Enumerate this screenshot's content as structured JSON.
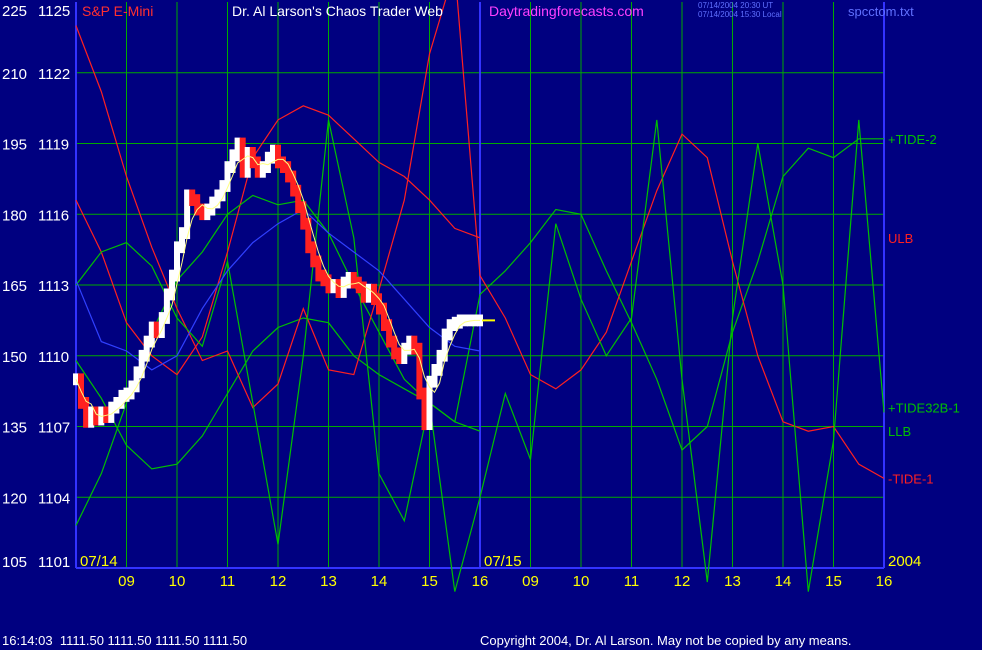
{
  "header": {
    "instrument": "S&P E-Mini",
    "title": "Dr. Al Larson's Chaos Trader Web",
    "site": "Daytradingforecasts.com",
    "timestamp_ut": "07/14/2004 20:30 UT",
    "timestamp_local": "07/14/2004 15:30 Local",
    "filename": "spcctom.txt"
  },
  "footer": {
    "quote": "16:14:03  1111.50 1111.50 1111.50 1111.50",
    "copyright": "Copyright 2004, Dr. Al Larson. May not be copied by any means."
  },
  "colors": {
    "background": "#000080",
    "frame": "#3333ff",
    "grid": "#00aa00",
    "axis_text": "#ffff00",
    "price_label": "#ffffff",
    "red": "#ff2020",
    "green": "#00c000",
    "white": "#ffffff"
  },
  "chart_data": {
    "type": "line",
    "x_unit": "hour of day (session 07/14 starts at 08, session 07/15 starts at 16)",
    "left_axis_outer": {
      "range": [
        105,
        225
      ],
      "ticks": [
        225,
        210,
        195,
        180,
        165,
        150,
        135,
        120,
        105
      ]
    },
    "left_axis_inner": {
      "range": [
        1101,
        1125
      ],
      "ticks": [
        1125,
        1122,
        1119,
        1116,
        1113,
        1110,
        1107,
        1104,
        1101
      ]
    },
    "day_markers": [
      {
        "label": "07/14",
        "x": 8
      },
      {
        "label": "07/15",
        "x": 16
      },
      {
        "label": "2004",
        "x": 24
      }
    ],
    "hour_ticks": [
      {
        "label": "09",
        "x": 9
      },
      {
        "label": "10",
        "x": 10
      },
      {
        "label": "11",
        "x": 11
      },
      {
        "label": "12",
        "x": 12
      },
      {
        "label": "13",
        "x": 13
      },
      {
        "label": "14",
        "x": 14
      },
      {
        "label": "15",
        "x": 15
      },
      {
        "label": "16",
        "x": 16
      },
      {
        "label": "09",
        "x": 17
      },
      {
        "label": "10",
        "x": 18
      },
      {
        "label": "11",
        "x": 19
      },
      {
        "label": "12",
        "x": 20
      },
      {
        "label": "13",
        "x": 21
      },
      {
        "label": "14",
        "x": 22
      },
      {
        "label": "15",
        "x": 23
      },
      {
        "label": "16",
        "x": 24
      }
    ],
    "grid": true,
    "price_bars": {
      "name": "S&P E-Mini",
      "x": [
        8.0,
        8.1,
        8.2,
        8.3,
        8.4,
        8.5,
        8.6,
        8.7,
        8.8,
        8.9,
        9.0,
        9.1,
        9.2,
        9.3,
        9.4,
        9.5,
        9.6,
        9.7,
        9.8,
        9.9,
        10.0,
        10.1,
        10.2,
        10.3,
        10.4,
        10.5,
        10.6,
        10.7,
        10.8,
        10.9,
        11.0,
        11.1,
        11.2,
        11.3,
        11.4,
        11.5,
        11.6,
        11.7,
        11.8,
        11.9,
        12.0,
        12.1,
        12.2,
        12.3,
        12.4,
        12.5,
        12.6,
        12.7,
        12.8,
        12.9,
        13.0,
        13.1,
        13.2,
        13.3,
        13.4,
        13.5,
        13.6,
        13.7,
        13.8,
        13.9,
        14.0,
        14.1,
        14.2,
        14.3,
        14.4,
        14.5,
        14.6,
        14.7,
        14.8,
        14.9,
        15.0,
        15.1,
        15.2,
        15.3,
        15.4,
        15.5,
        15.6,
        15.7,
        15.8,
        15.9,
        16.0
      ],
      "close": [
        1109.0,
        1108.0,
        1107.2,
        1107.6,
        1107.3,
        1107.6,
        1107.4,
        1107.8,
        1108.0,
        1108.3,
        1108.4,
        1108.7,
        1109.3,
        1110.0,
        1110.6,
        1111.2,
        1111.0,
        1111.6,
        1112.6,
        1113.4,
        1114.6,
        1115.2,
        1116.8,
        1116.6,
        1116.2,
        1116.0,
        1116.2,
        1116.5,
        1116.8,
        1117.2,
        1118.0,
        1118.5,
        1119.0,
        1117.8,
        1118.6,
        1118.2,
        1117.8,
        1118.0,
        1118.4,
        1118.7,
        1118.2,
        1118.0,
        1117.6,
        1117.0,
        1116.3,
        1115.6,
        1114.6,
        1114.0,
        1113.4,
        1113.2,
        1112.9,
        1113.0,
        1112.7,
        1113.1,
        1113.3,
        1113.1,
        1112.9,
        1112.5,
        1112.8,
        1112.4,
        1112.0,
        1111.3,
        1110.6,
        1110.1,
        1109.9,
        1110.3,
        1110.6,
        1110.3,
        1108.4,
        1107.1,
        1108.9,
        1109.4,
        1110.0,
        1110.9,
        1111.3,
        1111.4,
        1111.5,
        1111.5,
        1111.5,
        1111.5,
        1111.5
      ],
      "last": 1111.5
    },
    "series": [
      {
        "name": "ULB",
        "color": "#ff2020",
        "x": [
          8.0,
          8.5,
          9.0,
          9.5,
          10.0,
          10.5,
          11.0,
          11.5,
          12.0,
          12.5,
          13.0,
          13.5,
          14.0,
          14.5,
          15.0,
          15.5,
          16.0
        ],
        "y": [
          183,
          172,
          157,
          150,
          146,
          154,
          172,
          192,
          200,
          203,
          201,
          196,
          191,
          188,
          183,
          177,
          175
        ]
      },
      {
        "name": "LLB",
        "color": "#00c000",
        "x": [
          8.0,
          8.5,
          9.0,
          9.5,
          10.0,
          10.5,
          11.0,
          11.5,
          12.0,
          12.5,
          13.0,
          13.5,
          14.0,
          14.5,
          15.0,
          15.5,
          16.0
        ],
        "y": [
          149,
          141,
          131,
          126,
          127,
          133,
          142,
          151,
          156,
          158,
          157,
          150,
          146,
          143,
          140,
          136,
          134
        ]
      },
      {
        "name": "+TIDE-2",
        "color": "#00c000",
        "x": [
          8.0,
          8.5,
          9.0,
          9.5,
          10.0,
          10.5,
          11.0,
          11.5,
          12.0,
          12.5,
          13.0,
          13.5,
          14.0,
          14.5,
          15.0,
          15.5,
          16.0,
          16.5,
          17.0,
          17.5,
          18.0,
          18.5,
          19.0,
          19.5,
          20.0,
          20.5,
          21.0,
          21.5,
          22.0,
          22.5,
          23.0,
          23.5,
          24.0
        ],
        "y": [
          114,
          125,
          140,
          155,
          166,
          172,
          180,
          184,
          182,
          183,
          176,
          165,
          155,
          145,
          140,
          136,
          163,
          168,
          174,
          181,
          180,
          168,
          157,
          145,
          130,
          135,
          155,
          170,
          188,
          194,
          192,
          196,
          196
        ]
      },
      {
        "name": "-TIDE-1",
        "color": "#ff2020",
        "x": [
          8.0,
          8.5,
          9.0,
          9.5,
          10.0,
          10.5,
          11.0,
          11.5,
          12.0,
          12.5,
          13.0,
          13.5,
          14.0,
          14.5,
          15.0,
          15.5,
          16.0,
          16.5,
          17.0,
          17.5,
          18.0,
          18.5,
          19.0,
          19.5,
          20.0,
          20.5,
          21.0,
          21.5,
          22.0,
          22.5,
          23.0,
          23.5,
          24.0
        ],
        "y": [
          220,
          206,
          188,
          173,
          160,
          149,
          151,
          139,
          144,
          160,
          147,
          146,
          164,
          183,
          214,
          232,
          167,
          158,
          146,
          143,
          147,
          155,
          170,
          185,
          197,
          192,
          170,
          150,
          136,
          134,
          135,
          127,
          124
        ]
      },
      {
        "name": "+TIDE32B-1",
        "color": "#00c000",
        "x": [
          8.0,
          8.5,
          9.0,
          9.5,
          10.0,
          10.5,
          11.0,
          11.5,
          12.0,
          12.5,
          13.0,
          13.5,
          14.0,
          14.5,
          15.0,
          15.5,
          16.0,
          16.5,
          17.0,
          17.5,
          18.0,
          18.5,
          19.0,
          19.5,
          20.0,
          20.5,
          21.0,
          21.5,
          22.0,
          22.5,
          23.0,
          23.5,
          24.0
        ],
        "y": [
          165,
          172,
          174,
          169,
          158,
          152,
          170,
          140,
          110,
          150,
          200,
          175,
          125,
          115,
          140,
          100,
          120,
          142,
          128,
          178,
          162,
          150,
          158,
          200,
          145,
          102,
          158,
          195,
          165,
          100,
          132,
          200,
          138
        ]
      },
      {
        "name": "",
        "color": "#3040ff",
        "x": [
          8.0,
          8.5,
          9.0,
          9.5,
          10.0,
          10.5,
          11.0,
          11.5,
          12.0,
          12.5,
          13.0,
          13.5,
          14.0,
          14.5,
          15.0,
          15.5,
          16.0
        ],
        "y": [
          166,
          153,
          151,
          147,
          150,
          160,
          168,
          174,
          178,
          181,
          176,
          172,
          168,
          162,
          156,
          152,
          151
        ]
      }
    ],
    "annotations": [
      {
        "label": "+TIDE-2",
        "series": "+TIDE-2",
        "color": "#00c000"
      },
      {
        "label": "ULB",
        "series": "ULB",
        "color": "#ff2020"
      },
      {
        "label": "+TIDE32B-1",
        "series": "+TIDE32B-1",
        "color": "#00c000"
      },
      {
        "label": "LLB",
        "series": "LLB",
        "color": "#00c000"
      },
      {
        "label": "-TIDE-1",
        "series": "-TIDE-1",
        "color": "#ff2020"
      }
    ]
  }
}
